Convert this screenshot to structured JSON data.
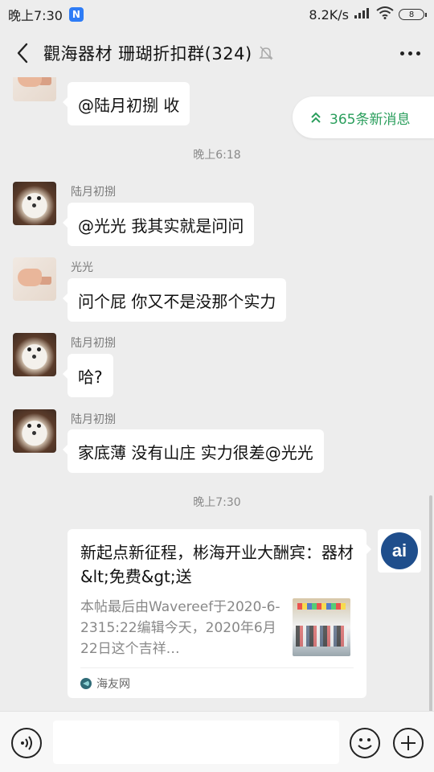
{
  "status_bar": {
    "time": "晚上7:30",
    "app_badge": "N",
    "net_speed": "8.2K/s",
    "battery": "8"
  },
  "header": {
    "title": "觀海器材 珊瑚折扣群(324)"
  },
  "new_messages": {
    "label": "365条新消息"
  },
  "timestamps": [
    "晚上6:18",
    "晚上7:30"
  ],
  "messages": [
    {
      "sender": "",
      "text": "@陆月初捌  收",
      "avatar": "fist"
    },
    {
      "sender": "陆月初捌",
      "text": "@光光  我其实就是问问",
      "avatar": "dog"
    },
    {
      "sender": "光光",
      "text": "问个屁 你又不是没那个实力",
      "avatar": "fist"
    },
    {
      "sender": "陆月初捌",
      "text": "哈?",
      "avatar": "dog"
    },
    {
      "sender": "陆月初捌",
      "text": "家底薄 没有山庄 实力很差@光光",
      "avatar": "dog"
    }
  ],
  "link_card": {
    "title": "新起点新征程，彬海开业大酬宾：器材&lt;免费&gt;送",
    "description": "本帖最后由Wavereef于2020-6-2315:22编辑今天，2020年6月22日这个吉祥…",
    "source": "海友网",
    "bot_avatar_text": "ai"
  },
  "input": {
    "placeholder": ""
  }
}
